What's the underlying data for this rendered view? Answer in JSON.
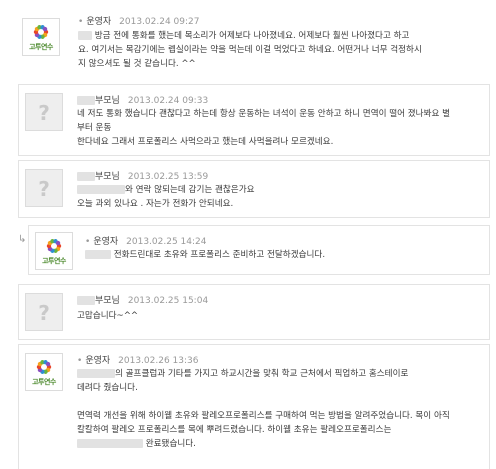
{
  "comments": [
    {
      "author": "운영자",
      "date": "2013.02.24 09:27",
      "lines": [
        "방금 전에 통화를 했는데 목소리가 어제보다 나아졌네요. 어제보다 훨씬 나아졌다고 하고",
        "요. 여기서는 목감기에는 렙실이라는 약을 먹는데 이걸 먹었다고 하네요. 어떤거나 너무 걱정하시",
        "지 않으셔도 될 것 같습니다. ^^"
      ]
    },
    {
      "author": "부모님",
      "date": "2013.02.24 09:33",
      "lines": [
        "네 저도 통화 했습니다 괜찮다고 하는데 항상 운동하는 녀석이 운동 안하고 하니 면역이 떨어 졌나봐요 별",
        "부터 운동",
        "한다네요 그래서 프로폴리스 사먹으라고 했는데 사먹을려나 모르겠네요."
      ]
    },
    {
      "author": "부모님",
      "date": "2013.02.25 13:59",
      "lines": [
        "와 연락 않되는데 감기는 괜찮은가요",
        "오늘 과외 있나요 . 자는가 전화가 안되네요."
      ]
    },
    {
      "author": "운영자",
      "date": "2013.02.25 14:24",
      "lines": [
        "전화드린대로 초유와 프로폴리스 준비하고 전달하겠습니다."
      ]
    },
    {
      "author": "부모님",
      "date": "2013.02.25 15:04",
      "lines": [
        "고맙습니다~^^"
      ]
    },
    {
      "author": "운영자",
      "date": "2013.02.26 13:36",
      "lines": [
        "의 골프클럽과 기타를 가지고 하교시간을 맞춰 학교 근처에서 픽업하고 홈스테이로",
        "데려다 줬습니다.",
        "",
        "면역력 개선을 위해 하이웰 초유와 팔레오프로폴리스를 구매하여 먹는 방법을 알려주었습니다. 목이 아직",
        "칼칼하여 팔레오 프로폴리스를 목에 뿌려드렸습니다. 하이웰 초유는 팔레오프로폴리스는",
        "완료됐습니다."
      ]
    }
  ],
  "logo_text": "고투연수",
  "logo_colors": [
    "#e8452c",
    "#f4a21d",
    "#6ab53e",
    "#2f8fd1",
    "#8a4fbf"
  ]
}
